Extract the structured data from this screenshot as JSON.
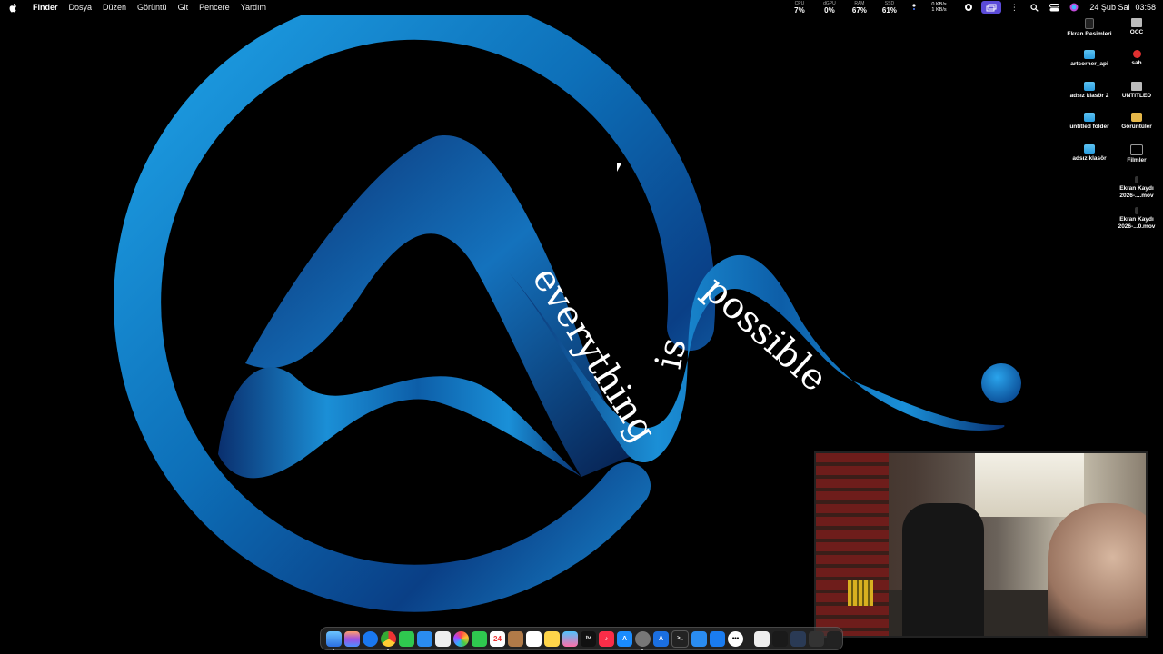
{
  "menubar": {
    "apple_icon": "",
    "app_name": "Finder",
    "menus": [
      "Dosya",
      "Düzen",
      "Görüntü",
      "Git",
      "Pencere",
      "Yardım"
    ],
    "stats": [
      {
        "label": "CPU",
        "value": "7%"
      },
      {
        "label": "dGPU",
        "value": "0%"
      },
      {
        "label": "RAM",
        "value": "67%"
      },
      {
        "label": "SSD",
        "value": "61%"
      }
    ],
    "network": {
      "up": "0 KB/s",
      "down": "1 KB/s"
    },
    "date": "24 Şub Sal",
    "time": "03:58"
  },
  "wallpaper": {
    "slogan_1": "everything",
    "slogan_2": "is",
    "slogan_3": "possible",
    "colors": {
      "blue_light": "#1b8fd6",
      "blue_dark": "#0a2f6e"
    }
  },
  "desktop_icons": [
    {
      "label": "Ekran Resimleri",
      "icon": "screenshot-folder-icon"
    },
    {
      "label": "OCC",
      "icon": "drive-icon"
    },
    {
      "label": "artcorner_api",
      "icon": "folder-icon"
    },
    {
      "label": "sah",
      "icon": "apple-icon"
    },
    {
      "label": "adsız klasör 2",
      "icon": "folder-icon"
    },
    {
      "label": "UNTITLED",
      "icon": "drive-icon"
    },
    {
      "label": "untitled folder",
      "icon": "folder-icon"
    },
    {
      "label": "Görüntüler",
      "icon": "image-folder-icon"
    },
    {
      "label": "adsız klasör",
      "icon": "folder-icon"
    },
    {
      "label": "Filmler",
      "icon": "movies-folder-icon"
    },
    {
      "label": "Ekran Kaydı 2026-....mov",
      "icon": "movie-file-icon"
    },
    {
      "label": "Ekran Kaydı 2026-...0.mov",
      "icon": "movie-file-icon"
    }
  ],
  "dock": {
    "date_badge": "24",
    "tv_label": "tv"
  }
}
